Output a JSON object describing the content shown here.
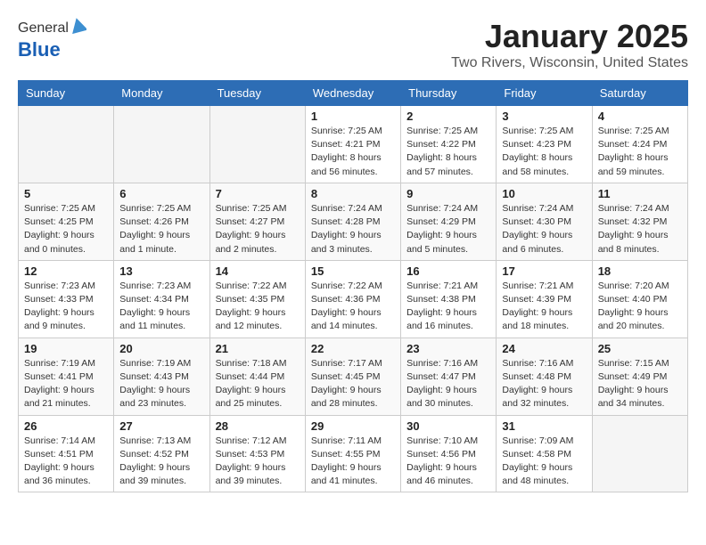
{
  "logo": {
    "general": "General",
    "blue": "Blue"
  },
  "title": "January 2025",
  "location": "Two Rivers, Wisconsin, United States",
  "days_of_week": [
    "Sunday",
    "Monday",
    "Tuesday",
    "Wednesday",
    "Thursday",
    "Friday",
    "Saturday"
  ],
  "weeks": [
    [
      {
        "day": "",
        "info": ""
      },
      {
        "day": "",
        "info": ""
      },
      {
        "day": "",
        "info": ""
      },
      {
        "day": "1",
        "info": "Sunrise: 7:25 AM\nSunset: 4:21 PM\nDaylight: 8 hours\nand 56 minutes."
      },
      {
        "day": "2",
        "info": "Sunrise: 7:25 AM\nSunset: 4:22 PM\nDaylight: 8 hours\nand 57 minutes."
      },
      {
        "day": "3",
        "info": "Sunrise: 7:25 AM\nSunset: 4:23 PM\nDaylight: 8 hours\nand 58 minutes."
      },
      {
        "day": "4",
        "info": "Sunrise: 7:25 AM\nSunset: 4:24 PM\nDaylight: 8 hours\nand 59 minutes."
      }
    ],
    [
      {
        "day": "5",
        "info": "Sunrise: 7:25 AM\nSunset: 4:25 PM\nDaylight: 9 hours\nand 0 minutes."
      },
      {
        "day": "6",
        "info": "Sunrise: 7:25 AM\nSunset: 4:26 PM\nDaylight: 9 hours\nand 1 minute."
      },
      {
        "day": "7",
        "info": "Sunrise: 7:25 AM\nSunset: 4:27 PM\nDaylight: 9 hours\nand 2 minutes."
      },
      {
        "day": "8",
        "info": "Sunrise: 7:24 AM\nSunset: 4:28 PM\nDaylight: 9 hours\nand 3 minutes."
      },
      {
        "day": "9",
        "info": "Sunrise: 7:24 AM\nSunset: 4:29 PM\nDaylight: 9 hours\nand 5 minutes."
      },
      {
        "day": "10",
        "info": "Sunrise: 7:24 AM\nSunset: 4:30 PM\nDaylight: 9 hours\nand 6 minutes."
      },
      {
        "day": "11",
        "info": "Sunrise: 7:24 AM\nSunset: 4:32 PM\nDaylight: 9 hours\nand 8 minutes."
      }
    ],
    [
      {
        "day": "12",
        "info": "Sunrise: 7:23 AM\nSunset: 4:33 PM\nDaylight: 9 hours\nand 9 minutes."
      },
      {
        "day": "13",
        "info": "Sunrise: 7:23 AM\nSunset: 4:34 PM\nDaylight: 9 hours\nand 11 minutes."
      },
      {
        "day": "14",
        "info": "Sunrise: 7:22 AM\nSunset: 4:35 PM\nDaylight: 9 hours\nand 12 minutes."
      },
      {
        "day": "15",
        "info": "Sunrise: 7:22 AM\nSunset: 4:36 PM\nDaylight: 9 hours\nand 14 minutes."
      },
      {
        "day": "16",
        "info": "Sunrise: 7:21 AM\nSunset: 4:38 PM\nDaylight: 9 hours\nand 16 minutes."
      },
      {
        "day": "17",
        "info": "Sunrise: 7:21 AM\nSunset: 4:39 PM\nDaylight: 9 hours\nand 18 minutes."
      },
      {
        "day": "18",
        "info": "Sunrise: 7:20 AM\nSunset: 4:40 PM\nDaylight: 9 hours\nand 20 minutes."
      }
    ],
    [
      {
        "day": "19",
        "info": "Sunrise: 7:19 AM\nSunset: 4:41 PM\nDaylight: 9 hours\nand 21 minutes."
      },
      {
        "day": "20",
        "info": "Sunrise: 7:19 AM\nSunset: 4:43 PM\nDaylight: 9 hours\nand 23 minutes."
      },
      {
        "day": "21",
        "info": "Sunrise: 7:18 AM\nSunset: 4:44 PM\nDaylight: 9 hours\nand 25 minutes."
      },
      {
        "day": "22",
        "info": "Sunrise: 7:17 AM\nSunset: 4:45 PM\nDaylight: 9 hours\nand 28 minutes."
      },
      {
        "day": "23",
        "info": "Sunrise: 7:16 AM\nSunset: 4:47 PM\nDaylight: 9 hours\nand 30 minutes."
      },
      {
        "day": "24",
        "info": "Sunrise: 7:16 AM\nSunset: 4:48 PM\nDaylight: 9 hours\nand 32 minutes."
      },
      {
        "day": "25",
        "info": "Sunrise: 7:15 AM\nSunset: 4:49 PM\nDaylight: 9 hours\nand 34 minutes."
      }
    ],
    [
      {
        "day": "26",
        "info": "Sunrise: 7:14 AM\nSunset: 4:51 PM\nDaylight: 9 hours\nand 36 minutes."
      },
      {
        "day": "27",
        "info": "Sunrise: 7:13 AM\nSunset: 4:52 PM\nDaylight: 9 hours\nand 39 minutes."
      },
      {
        "day": "28",
        "info": "Sunrise: 7:12 AM\nSunset: 4:53 PM\nDaylight: 9 hours\nand 39 minutes."
      },
      {
        "day": "29",
        "info": "Sunrise: 7:11 AM\nSunset: 4:55 PM\nDaylight: 9 hours\nand 41 minutes."
      },
      {
        "day": "30",
        "info": "Sunrise: 7:10 AM\nSunset: 4:56 PM\nDaylight: 9 hours\nand 46 minutes."
      },
      {
        "day": "31",
        "info": "Sunrise: 7:09 AM\nSunset: 4:58 PM\nDaylight: 9 hours\nand 48 minutes."
      },
      {
        "day": "",
        "info": ""
      }
    ]
  ]
}
